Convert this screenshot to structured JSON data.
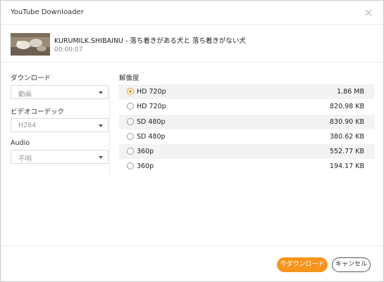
{
  "window": {
    "title": "YouTube Downloader",
    "close_icon": "close-icon"
  },
  "video": {
    "title": "KURUMILK.SHIBAINU - 落ち着きがある犬と 落ち着きがない犬",
    "duration": "00:00:07"
  },
  "options": {
    "download_label": "ダウンロード",
    "download_value": "動画",
    "codec_label": "ビデオコーデック",
    "codec_value": "H264",
    "audio_label": "Audio",
    "audio_value": "不明"
  },
  "resolutions": {
    "header": "解像度",
    "items": [
      {
        "label": "HD 720p",
        "size": "1.86 MB",
        "selected": true
      },
      {
        "label": "HD 720p",
        "size": "820.98 KB",
        "selected": false
      },
      {
        "label": "SD 480p",
        "size": "830.90 KB",
        "selected": false
      },
      {
        "label": "SD 480p",
        "size": "380.62 KB",
        "selected": false
      },
      {
        "label": "360p",
        "size": "552.77 KB",
        "selected": false
      },
      {
        "label": "360p",
        "size": "194.17 KB",
        "selected": false
      }
    ]
  },
  "footer": {
    "download_now_label": "今ダウンロード",
    "cancel_label": "キャンセル"
  },
  "colors": {
    "accent": "#f7941d",
    "radio_selected": "#f39a1c",
    "alt_row": "#f3f3f3"
  }
}
